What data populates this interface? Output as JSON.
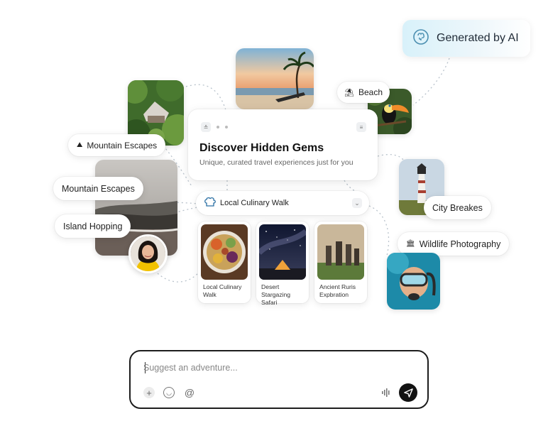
{
  "badge": {
    "label": "Generated by AI",
    "icon": "brain-icon"
  },
  "main_card": {
    "title": "Discover Hidden Gems",
    "subtitle": "Unique, curated travel experiences just for you"
  },
  "tags": {
    "beach": "Beach",
    "mountain_top": "Mountain Escapes",
    "mountain_left": "Mountain Escapes",
    "island": "Island Hopping",
    "city": "City Breakes",
    "wildlife": "Wildlife Photography"
  },
  "culinary_pill": {
    "label": "Local Culinary Walk"
  },
  "experiences": [
    {
      "caption": "Local Culinary Walk"
    },
    {
      "caption": "Desert Stargazing Safari"
    },
    {
      "caption": "Ancient Ruris Expbration"
    }
  ],
  "chat": {
    "placeholder": "Suggest an adventure..."
  },
  "colors": {
    "accent": "#cdeef8",
    "send": "#121212"
  }
}
